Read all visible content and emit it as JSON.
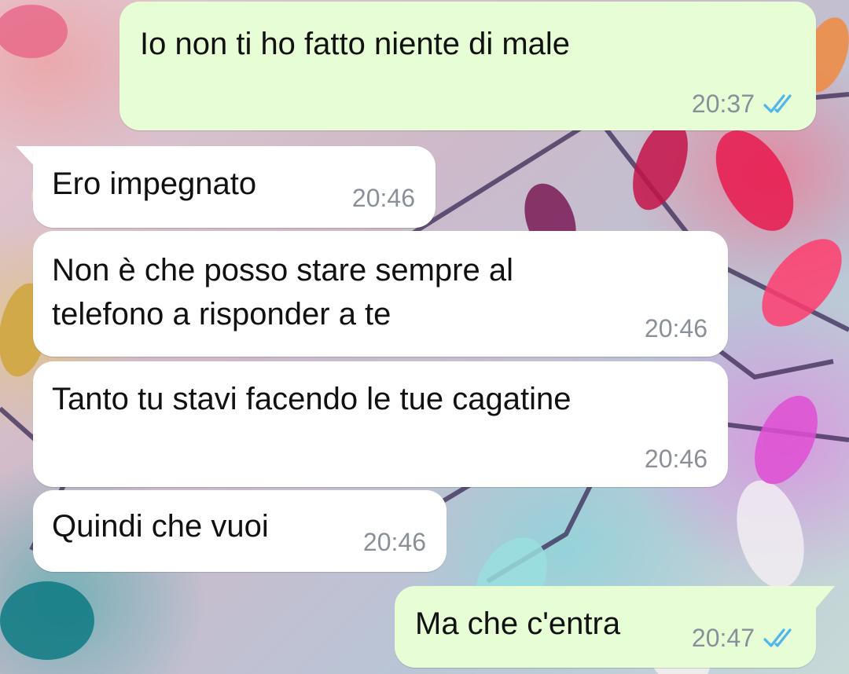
{
  "colors": {
    "outgoing_bubble": "#e7fdd5",
    "incoming_bubble": "#ffffff",
    "timestamp": "#8a9099",
    "read_ticks": "#4fb6ec"
  },
  "messages": [
    {
      "direction": "outgoing",
      "text": "Io non ti ho fatto niente di male",
      "time": "20:37",
      "status_icon": "double-check-read-icon"
    },
    {
      "direction": "incoming",
      "text": "Ero impegnato",
      "time": "20:46"
    },
    {
      "direction": "incoming",
      "text": "Non è che posso stare sempre al\ntelefono a risponder a te",
      "time": "20:46"
    },
    {
      "direction": "incoming",
      "text": "Tanto tu stavi facendo le tue cagatine",
      "time": "20:46"
    },
    {
      "direction": "incoming",
      "text": "Quindi che vuoi",
      "time": "20:46"
    },
    {
      "direction": "outgoing",
      "text": "Ma che c'entra",
      "time": "20:47",
      "status_icon": "double-check-read-icon"
    }
  ]
}
